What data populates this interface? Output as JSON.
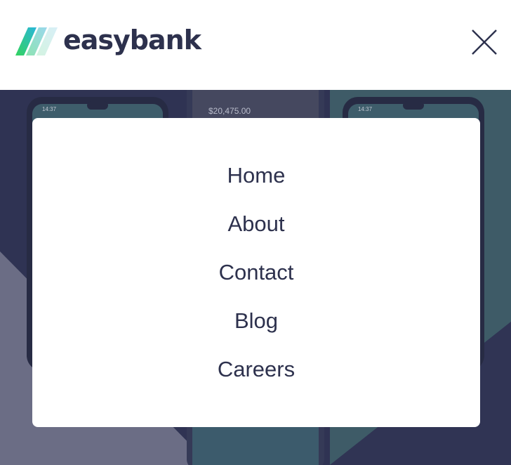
{
  "header": {
    "brand_name": "easybank",
    "logo_icon": "easybank-stripes-logo",
    "close_icon": "close-icon"
  },
  "hero": {
    "phone_balance": "$20,475.00",
    "phone_time_left": "14:37",
    "phone_time_right": "14:37"
  },
  "menu": {
    "items": [
      {
        "label": "Home"
      },
      {
        "label": "About"
      },
      {
        "label": "Contact"
      },
      {
        "label": "Blog"
      },
      {
        "label": "Careers"
      }
    ]
  },
  "colors": {
    "text_dark_blue": "#2d314d",
    "overlay_navy": "#2f3353",
    "lime": "#31d35c",
    "cyan": "#2bb7da"
  }
}
